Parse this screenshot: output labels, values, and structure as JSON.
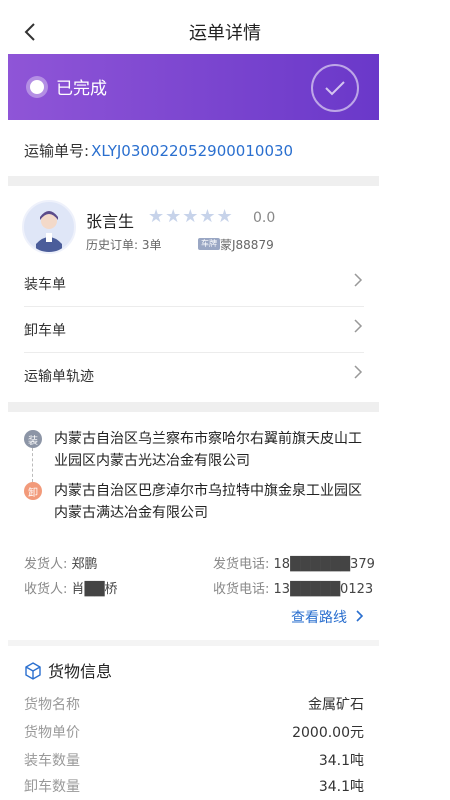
{
  "header": {
    "title": "运单详情"
  },
  "status": {
    "text": "已完成",
    "accent": "#7b45d0"
  },
  "order": {
    "label": "运输单号:",
    "number": "XLYJ030022052900010030"
  },
  "driver": {
    "name": "张言生",
    "stars": "★★★★★",
    "rating": "0.0",
    "history": "历史订单: 3单",
    "plate_badge": "车牌",
    "plate": "蒙J88879"
  },
  "menu": [
    {
      "label": "装车单"
    },
    {
      "label": "卸车单"
    },
    {
      "label": "运输单轨迹"
    }
  ],
  "route": {
    "load_icon": "装",
    "load_address": "内蒙古自治区乌兰察布市察哈尔右翼前旗天皮山工业园区内蒙古光达冶金有限公司",
    "unload_icon": "卸",
    "unload_address": "内蒙古自治区巴彦淖尔市乌拉特中旗金泉工业园区内蒙古满达冶金有限公司"
  },
  "contacts": {
    "shipper_label": "发货人:",
    "shipper": "郑鹏",
    "shipper_phone_label": "发货电话:",
    "shipper_phone": "18██████379",
    "receiver_label": "收货人:",
    "receiver": "肖██桥",
    "receiver_phone_label": "收货电话:",
    "receiver_phone": "13█████0123"
  },
  "route_link": "查看路线",
  "cargo": {
    "title": "货物信息",
    "rows": [
      {
        "k": "货物名称",
        "v": "金属矿石"
      },
      {
        "k": "货物单价",
        "v": "2000.00元"
      },
      {
        "k": "装车数量",
        "v": "34.1吨"
      },
      {
        "k": "卸车数量",
        "v": "34.1吨"
      }
    ]
  }
}
